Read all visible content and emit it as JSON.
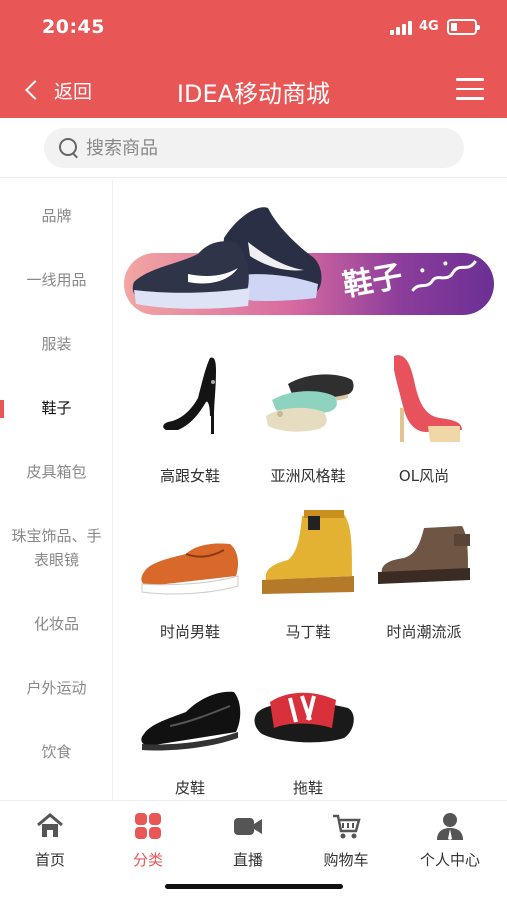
{
  "status_bar": {
    "time": "20:45",
    "network": "4G",
    "battery_level": 0.25
  },
  "header": {
    "back_label": "返回",
    "title": "IDEA移动商城",
    "menu_icon": "hamburger-menu-icon"
  },
  "search": {
    "placeholder": "搜索商品"
  },
  "sidebar": {
    "items": [
      {
        "label": "品牌"
      },
      {
        "label": "一线用品"
      },
      {
        "label": "服装"
      },
      {
        "label": "鞋子",
        "active": true
      },
      {
        "label": "皮具箱包"
      },
      {
        "label": "珠宝饰品、手表眼镜"
      },
      {
        "label": "化妆品"
      },
      {
        "label": "户外运动"
      },
      {
        "label": "饮食"
      }
    ]
  },
  "banner": {
    "label": "鞋子",
    "icon": "sneakers-image",
    "colors": [
      "#f2a6a3",
      "#6b2f94"
    ]
  },
  "products": [
    {
      "label": "高跟女鞋",
      "icon": "black-high-heel-image"
    },
    {
      "label": "亚洲风格鞋",
      "icon": "flat-shoes-image"
    },
    {
      "label": "OL风尚",
      "icon": "pink-platform-heel-image"
    },
    {
      "label": "时尚男鞋",
      "icon": "orange-suede-shoe-image"
    },
    {
      "label": "马丁鞋",
      "icon": "yellow-work-boot-image"
    },
    {
      "label": "时尚潮流派",
      "icon": "brown-boot-image"
    },
    {
      "label": "皮鞋",
      "icon": "black-leather-shoe-image"
    },
    {
      "label": "拖鞋",
      "icon": "slide-sandal-image"
    }
  ],
  "tabbar": {
    "items": [
      {
        "label": "首页",
        "icon": "home-icon"
      },
      {
        "label": "分类",
        "icon": "category-grid-icon",
        "active": true
      },
      {
        "label": "直播",
        "icon": "video-camera-icon"
      },
      {
        "label": "购物车",
        "icon": "shopping-cart-icon"
      },
      {
        "label": "个人中心",
        "icon": "user-profile-icon"
      }
    ]
  },
  "colors": {
    "brand": "#e95656",
    "text_muted": "#888888",
    "text_main": "#333333"
  }
}
